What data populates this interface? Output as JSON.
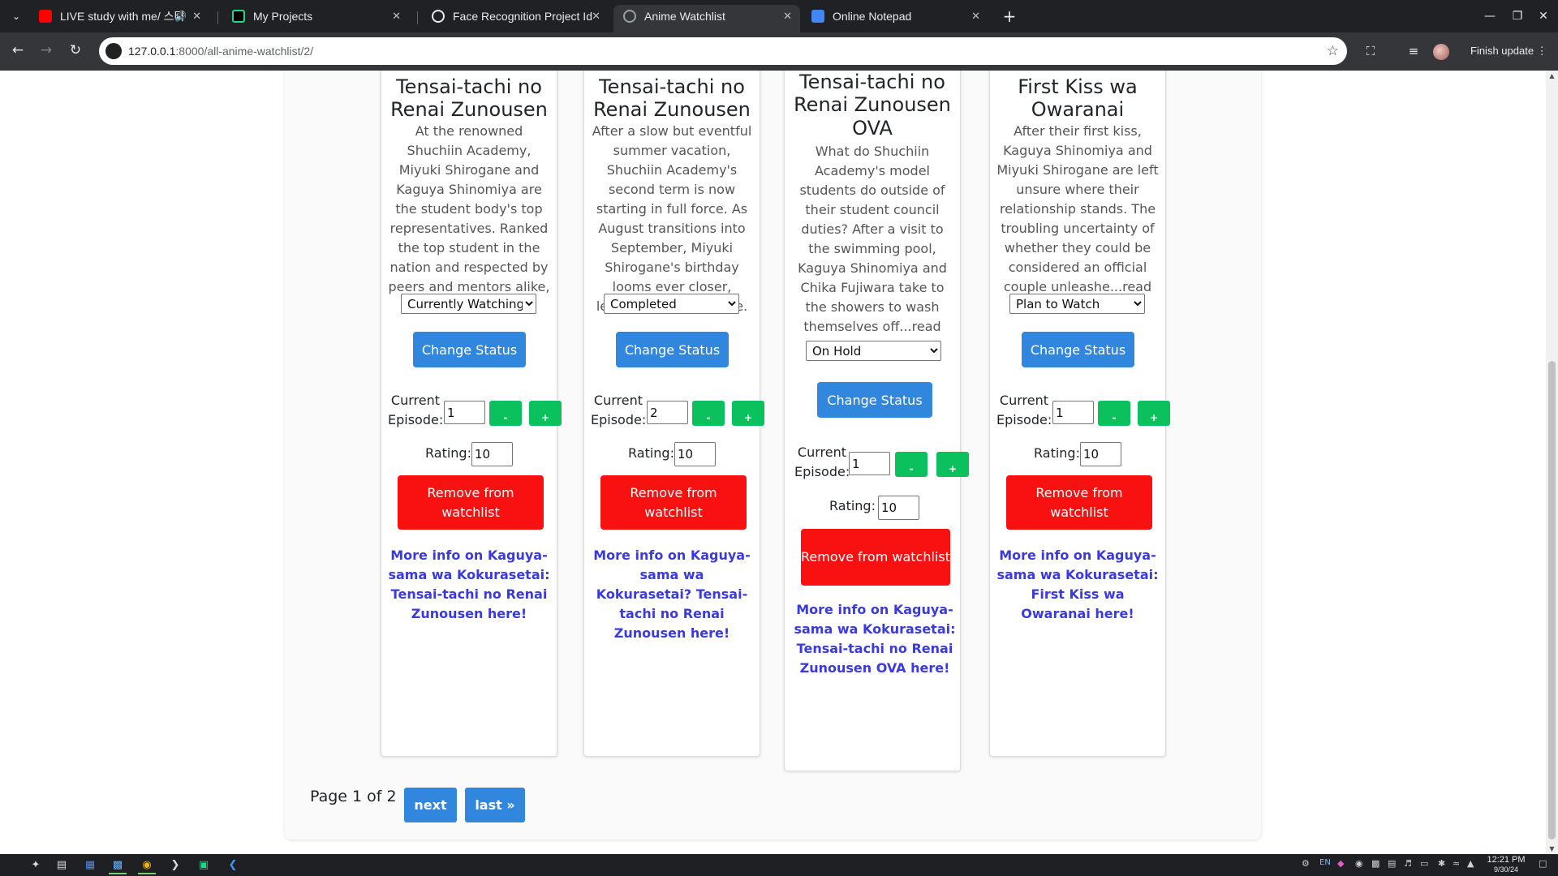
{
  "browser": {
    "tabs": [
      {
        "title": "LIVE study with me/ 스터",
        "favicon": "youtube-icon",
        "color": "#ff0000",
        "audio": true
      },
      {
        "title": "My Projects",
        "favicon": "pycharm-icon",
        "color": "#21d789"
      },
      {
        "title": "Face Recognition Project Id",
        "favicon": "chatgpt-icon",
        "color": "#ffffff"
      },
      {
        "title": "Anime Watchlist",
        "favicon": "globe-icon",
        "color": "#9aa0a6",
        "active": true
      },
      {
        "title": "Online Notepad",
        "favicon": "notepad-icon",
        "color": "#4285f4"
      }
    ],
    "url_host": "127.0.0.1",
    "url_path": ":8000/all-anime-watchlist/2/",
    "finish_update": "Finish update"
  },
  "cards": [
    {
      "title": "wa Kokurasetai: Tensai-tachi no Renai Zunousen",
      "description": "At the renowned Shuchiin Academy, Miyuki Shirogane and Kaguya Shinomiya are the student body's top representatives. Ranked the top student in the nation and respected by peers and mentors alike, Miyuk...read more.",
      "status": "Currently Watching",
      "change_status": "Change Status",
      "episode_label": "Current Episode:",
      "episode": "1",
      "minus": "-",
      "plus": "+",
      "rating_label": "Rating:",
      "rating": "10",
      "remove": "Remove from watchlist",
      "more_info": "More info on Kaguya-sama wa Kokurasetai: Tensai-tachi no Renai Zunousen here!"
    },
    {
      "title": "wa Kokurasetai? Tensai-tachi no Renai Zunousen",
      "description": "After a slow but eventful summer vacation, Shuchiin Academy's second term is now starting in full force. As August transitions into September, Miyuki Shirogane's birthday looms ever closer, leaving Ka...read more.",
      "status": "Completed",
      "change_status": "Change Status",
      "episode_label": "Current Episode:",
      "episode": "2",
      "minus": "-",
      "plus": "+",
      "rating_label": "Rating:",
      "rating": "10",
      "remove": "Remove from watchlist",
      "more_info": "More info on Kaguya-sama wa Kokurasetai? Tensai-tachi no Renai Zunousen here!"
    },
    {
      "title": "wa Kokurasetai: Tensai-tachi no Renai Zunousen OVA",
      "description": "What do Shuchiin Academy's model students do outside of their student council duties? After a visit to the swimming pool, Kaguya Shinomiya and Chika Fujiwara take to the showers to wash themselves off...read more.",
      "status": "On Hold",
      "change_status": "Change Status",
      "episode_label": "Current Episode:",
      "episode": "1",
      "minus": "-",
      "plus": "+",
      "rating_label": "Rating:",
      "rating": "10",
      "remove": "Remove from watchlist",
      "more_info": "More info on Kaguya-sama wa Kokurasetai: Tensai-tachi no Renai Zunousen OVA here!"
    },
    {
      "title": "wa Kokurasetai: First Kiss wa Owaranai",
      "description": "After their first kiss, Kaguya Shinomiya and Miyuki Shirogane are left unsure where their relationship stands. The troubling uncertainty of whether they could be considered an official couple unleashe...read more.",
      "status": "Plan to Watch",
      "change_status": "Change Status",
      "episode_label": "Current Episode:",
      "episode": "1",
      "minus": "-",
      "plus": "+",
      "rating_label": "Rating:",
      "rating": "10",
      "remove": "Remove from watchlist",
      "more_info": "More info on Kaguya-sama wa Kokurasetai: First Kiss wa Owaranai here!"
    }
  ],
  "pagination": {
    "indicator": "Page 1 of 2",
    "next": "next",
    "last": "last »"
  },
  "taskbar": {
    "language": "EN",
    "time": "12:21 PM",
    "date": "9/30/24"
  }
}
